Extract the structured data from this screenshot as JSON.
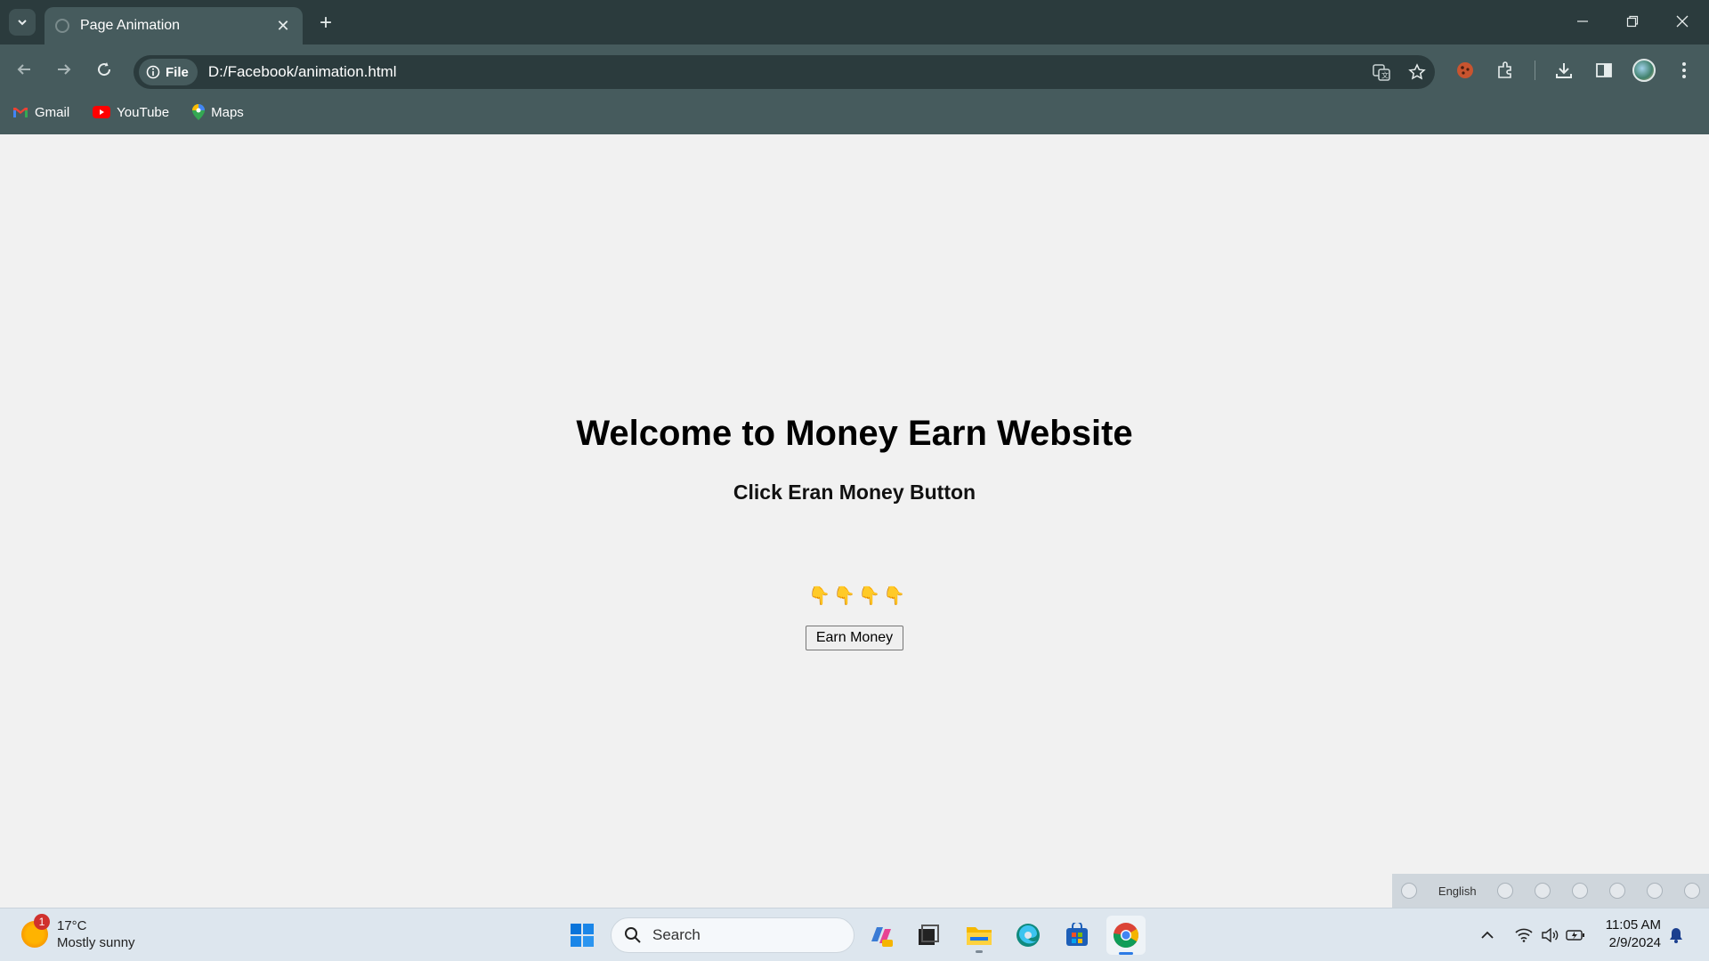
{
  "browser": {
    "tab_title": "Page Animation",
    "security_chip": "File",
    "url": "D:/Facebook/animation.html",
    "bookmarks": [
      {
        "label": "Gmail",
        "icon": "gmail-icon"
      },
      {
        "label": "YouTube",
        "icon": "youtube-icon"
      },
      {
        "label": "Maps",
        "icon": "maps-icon"
      }
    ]
  },
  "page": {
    "heading": "Welcome to Money Earn Website",
    "subheading": "Click Eran Money Button",
    "pointer_emoji": "👇",
    "pointer_count": 4,
    "button_label": "Earn Money"
  },
  "ime": {
    "language": "English"
  },
  "taskbar": {
    "weather_temp": "17°C",
    "weather_desc": "Mostly sunny",
    "weather_badge": "1",
    "search_placeholder": "Search",
    "time": "11:05 AM",
    "date": "2/9/2024"
  },
  "colors": {
    "tabstrip": "#2b3b3d",
    "toolbar": "#465b5d",
    "page_bg": "#f1f1f1",
    "taskbar": "#dde6ee"
  }
}
